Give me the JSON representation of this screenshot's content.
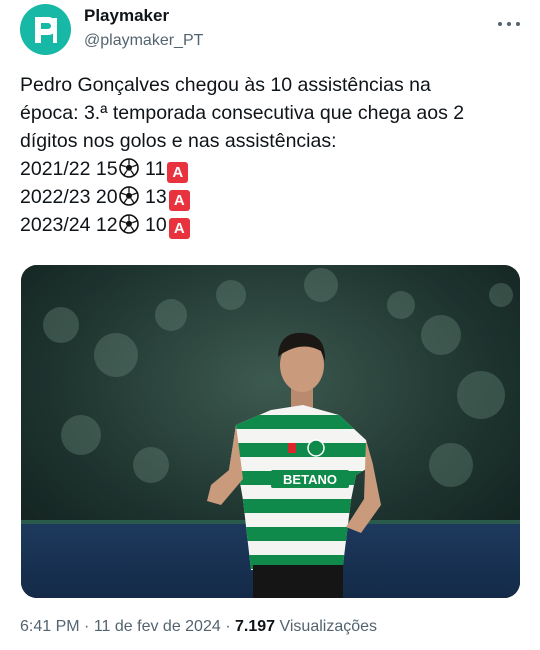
{
  "account": {
    "display_name": "Playmaker",
    "handle": "@playmaker_PT",
    "avatar_icon": "playmaker-logo-icon",
    "avatar_color": "#17b8a6"
  },
  "tweet": {
    "lines": [
      "Pedro Gonçalves chegou às 10 assistências na",
      "época: 3.ª temporada consecutiva que chega aos 2",
      "dígitos nos golos e nas assistências:"
    ],
    "seasons": [
      {
        "season": "2021/22",
        "goals": "15",
        "assists": "11"
      },
      {
        "season": "2022/23",
        "goals": "20",
        "assists": "13"
      },
      {
        "season": "2023/24",
        "goals": "12",
        "assists": "10"
      }
    ],
    "goal_icon": "soccer-ball-icon",
    "assist_badge": "A",
    "assist_badge_color": "#e8323d"
  },
  "media": {
    "type": "photo",
    "jersey_sponsor": "BETANO"
  },
  "footer": {
    "time": "6:41 PM",
    "separator": "·",
    "date": "11 de fev de 2024",
    "views_count": "7.197",
    "views_label": "Visualizações"
  }
}
